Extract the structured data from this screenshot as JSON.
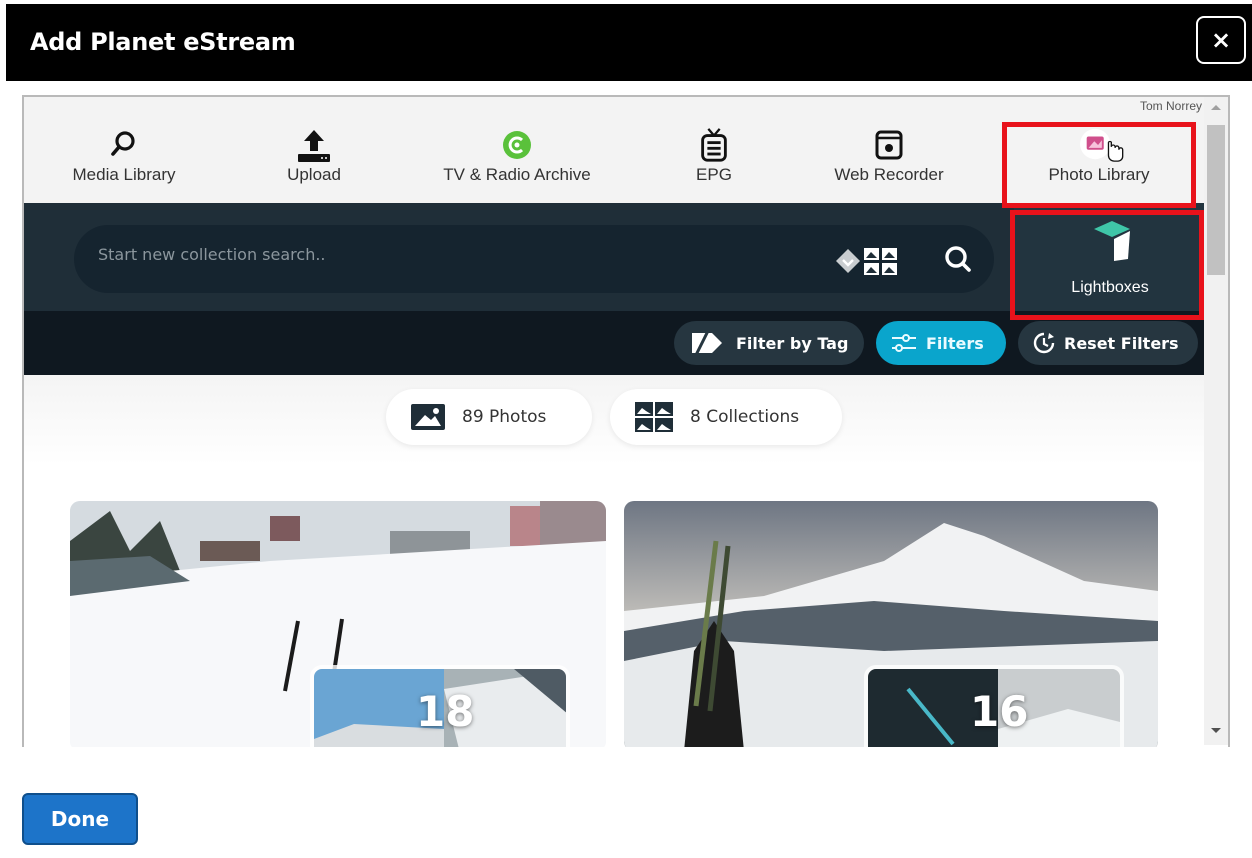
{
  "modal": {
    "title": "Add Planet eStream",
    "close_label": "×",
    "done_label": "Done"
  },
  "user": {
    "name": "Tom Norrey"
  },
  "nav": {
    "items": [
      {
        "label": "Media Library",
        "icon": "search-icon"
      },
      {
        "label": "Upload",
        "icon": "upload-icon"
      },
      {
        "label": "TV & Radio Archive",
        "icon": "archive-icon"
      },
      {
        "label": "EPG",
        "icon": "tv-guide-icon"
      },
      {
        "label": "Web Recorder",
        "icon": "web-recorder-icon"
      },
      {
        "label": "Photo Library",
        "icon": "photo-library-icon"
      }
    ]
  },
  "search": {
    "placeholder": "Start new collection search..",
    "lightboxes_label": "Lightboxes"
  },
  "filters": {
    "filter_by_tag": "Filter by Tag",
    "filters": "Filters",
    "reset_filters": "Reset Filters"
  },
  "counts": {
    "photos": "89 Photos",
    "collections": "8 Collections"
  },
  "cards": [
    {
      "count": "18"
    },
    {
      "count": "16"
    }
  ],
  "colors": {
    "highlight": "#e8121b",
    "accent": "#0aa5cc",
    "dark_band": "#1f2e38",
    "done_button": "#1d74c9"
  }
}
